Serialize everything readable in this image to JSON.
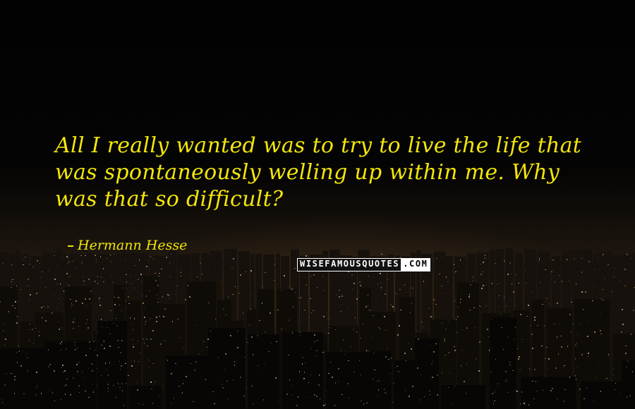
{
  "quote": {
    "text": "All I really wanted was to try to live the life that was spontaneously welling up within me. Why was that so difficult?"
  },
  "author": {
    "name": "Hermann Hesse"
  },
  "watermark": {
    "main": "WISEFAMOUSQUOTES",
    "tld": ".COM"
  },
  "colors": {
    "text": "#f2e60a",
    "background": "#050403"
  }
}
